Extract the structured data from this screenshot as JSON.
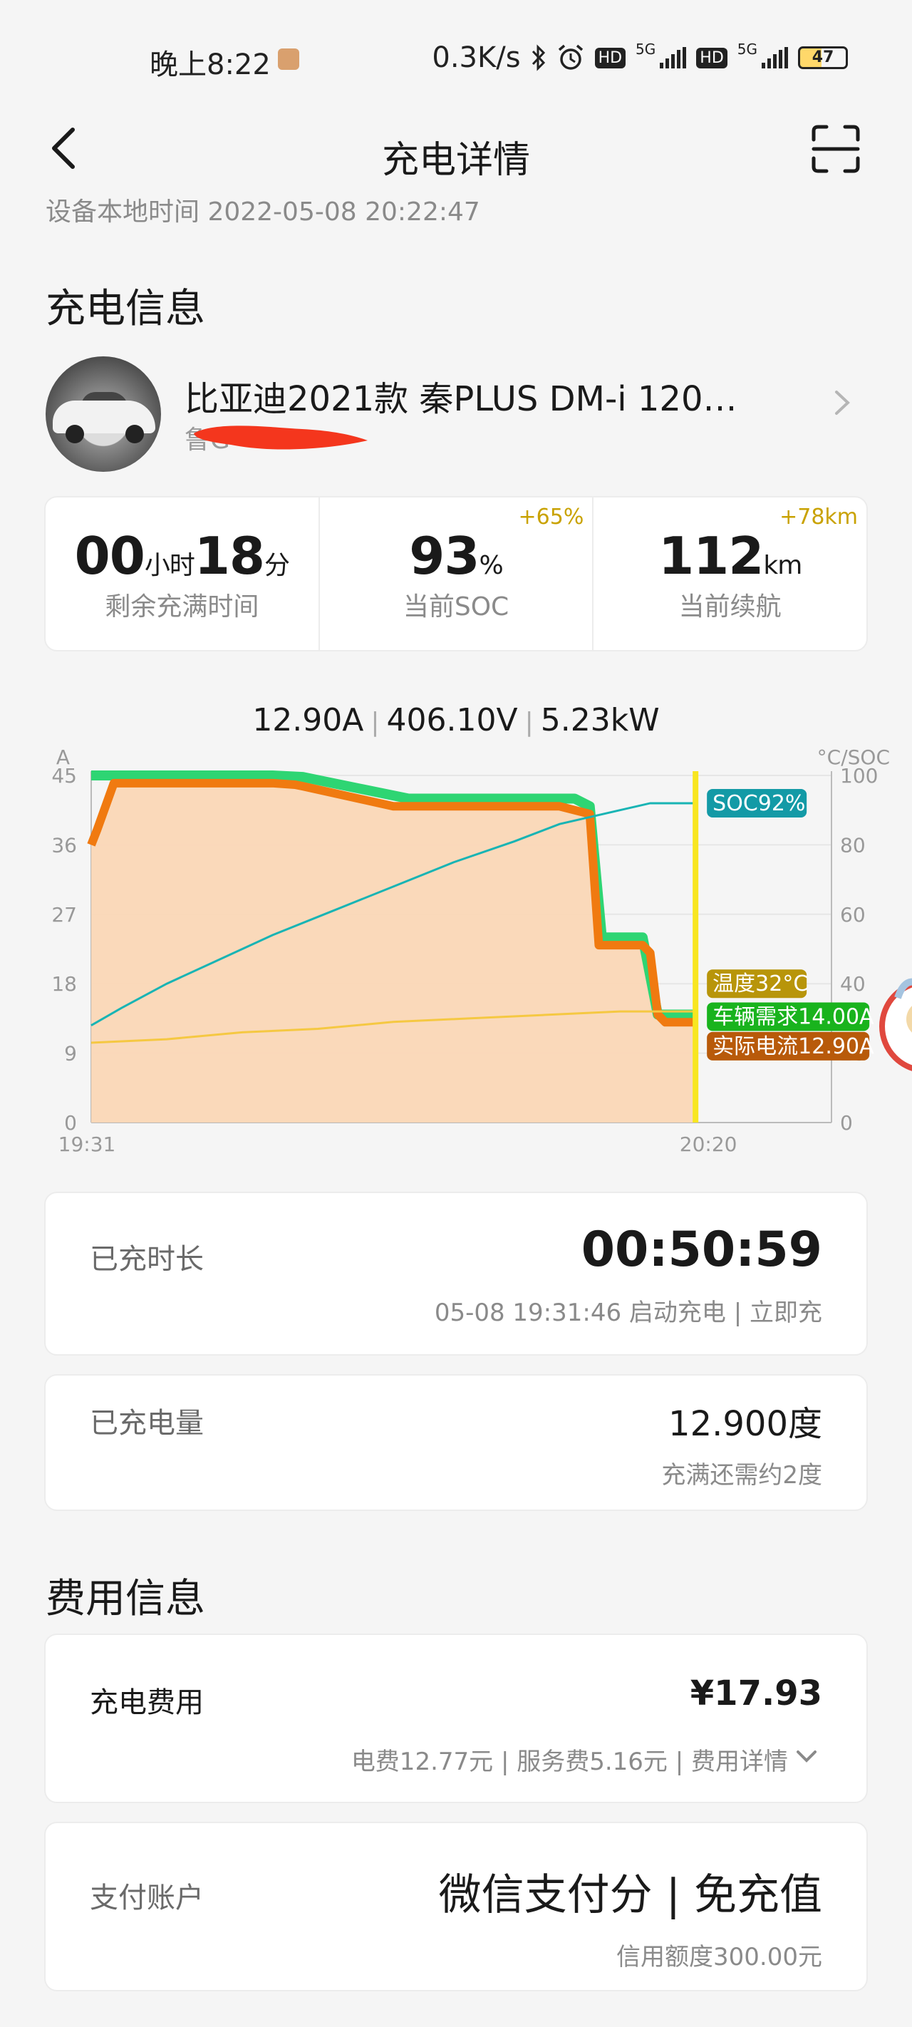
{
  "status_bar": {
    "time": "晚上8:22",
    "network_speed": "0.3K/s",
    "sim1_label": "HD",
    "sim2_label": "HD",
    "network_type_1": "5G",
    "network_type_2": "5G",
    "battery": "47"
  },
  "nav": {
    "title": "充电详情",
    "back_icon": "back-arrow-icon",
    "scan_icon": "scan-icon"
  },
  "device_time": "设备本地时间  2022-05-08 20:22:47",
  "charge_info": {
    "section_title": "充电信息",
    "car_name": "比亚迪2021款 秦PLUS DM-i 120…",
    "car_plate": "鲁G",
    "stats": [
      {
        "value": "00",
        "unit1": "小时",
        "value2": "18",
        "unit2": "分",
        "label": "剩余充满时间",
        "delta": ""
      },
      {
        "value": "93",
        "unit1": "%",
        "value2": "",
        "unit2": "",
        "label": "当前SOC",
        "delta": "+65%"
      },
      {
        "value": "112",
        "unit1": "km",
        "value2": "",
        "unit2": "",
        "label": "当前续航",
        "delta": "+78km"
      }
    ]
  },
  "chart_readout": {
    "current": "12.90A",
    "voltage": "406.10V",
    "power": "5.23kW"
  },
  "chart_data": {
    "type": "line",
    "x_start": "19:31",
    "x_end": "20:20",
    "xlabel": "",
    "left_axis": {
      "label": "A",
      "ticks": [
        0,
        9,
        18,
        27,
        36,
        45
      ],
      "ylim": [
        0,
        45
      ]
    },
    "right_axis": {
      "label": "°C/SOC",
      "ticks": [
        0,
        20,
        40,
        60,
        80,
        100
      ],
      "ylim": [
        0,
        100
      ]
    },
    "x_minutes": [
      0,
      1,
      3,
      8,
      14,
      20,
      24,
      26,
      29,
      34,
      40,
      42,
      43,
      45,
      47,
      48,
      49
    ],
    "series": [
      {
        "name": "车辆需求",
        "axis": "left",
        "color": "#2ed573",
        "label": "车辆需求14.00A",
        "x": [
          0,
          12,
          14,
          21,
          32,
          33,
          33.8,
          36.5,
          37.5,
          38,
          40
        ],
        "values": [
          45,
          45,
          44.8,
          42,
          42,
          41,
          24,
          24,
          14,
          14,
          14
        ]
      },
      {
        "name": "实际电流",
        "axis": "left",
        "color": "#f07a10",
        "label": "实际电流12.90A",
        "x": [
          0,
          0.4,
          1.5,
          12,
          13.5,
          14,
          20,
          30,
          31,
          32,
          33,
          33.6,
          36.5,
          37,
          37.5,
          38,
          40
        ],
        "values": [
          36,
          38,
          44,
          44,
          43.8,
          43.6,
          41,
          41,
          41,
          40.5,
          40,
          23,
          23,
          22,
          14,
          13,
          13
        ]
      },
      {
        "name": "SOC",
        "axis": "right",
        "color": "#18b4b4",
        "label": "SOC92%",
        "x": [
          0,
          2,
          5,
          8,
          12,
          16,
          20,
          24,
          28,
          31,
          34,
          37,
          40
        ],
        "values": [
          28,
          33,
          40,
          46,
          54,
          61,
          68,
          75,
          81,
          86,
          89,
          92,
          92
        ]
      },
      {
        "name": "温度",
        "axis": "right",
        "color": "#f5c842",
        "label": "温度32°C",
        "x": [
          0,
          5,
          10,
          15,
          20,
          25,
          30,
          35,
          40
        ],
        "values": [
          23,
          24,
          26,
          27,
          29,
          30,
          31,
          32,
          32
        ]
      }
    ],
    "cursor_x": 40,
    "x_total_minutes": 49
  },
  "charging": {
    "duration_label": "已充时长",
    "duration_value": "00:50:59",
    "duration_sub": "05-08 19:31:46 启动充电 | 立即充",
    "energy_label": "已充电量",
    "energy_value": "12.900度",
    "energy_sub": "充满还需约2度"
  },
  "fee_info": {
    "section_title": "费用信息",
    "fee_label": "充电费用",
    "fee_value": "¥17.93",
    "fee_sub": "电费12.77元 | 服务费5.16元 | 费用详情",
    "pay_label": "支付账户",
    "pay_value": "微信支付分 | 免充值",
    "pay_sub": "信用额度300.00元"
  },
  "colors": {
    "accent_yellow": "#c9a200",
    "cursor": "#f8e620",
    "orange_fill": "#fbd6b4"
  }
}
